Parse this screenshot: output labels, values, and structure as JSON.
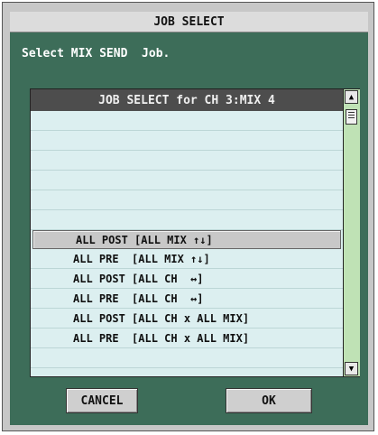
{
  "dialog": {
    "title": "JOB SELECT",
    "instruction": "Select MIX SEND  Job."
  },
  "list": {
    "header": "JOB SELECT for CH 3:MIX 4",
    "rows": [
      "",
      "",
      "",
      "",
      "",
      "",
      "ALL POST [ALL MIX ↑↓]",
      "ALL PRE  [ALL MIX ↑↓]",
      "ALL POST [ALL CH  ↔]",
      "ALL PRE  [ALL CH  ↔]",
      "ALL POST [ALL CH x ALL MIX]",
      "ALL PRE  [ALL CH x ALL MIX]",
      ""
    ],
    "selected_row": "ALL POST [ALL MIX ↑↓]"
  },
  "scrollbar": {
    "up_icon": "arrow-up-icon",
    "down_icon": "arrow-down-icon"
  },
  "buttons": {
    "cancel": "CANCEL",
    "ok": "OK"
  },
  "colors": {
    "panel": "#3d6d59",
    "list_bg": "#dceff0",
    "header_bg": "#4d4d4d",
    "scroll_track": "#bfe2b5"
  }
}
